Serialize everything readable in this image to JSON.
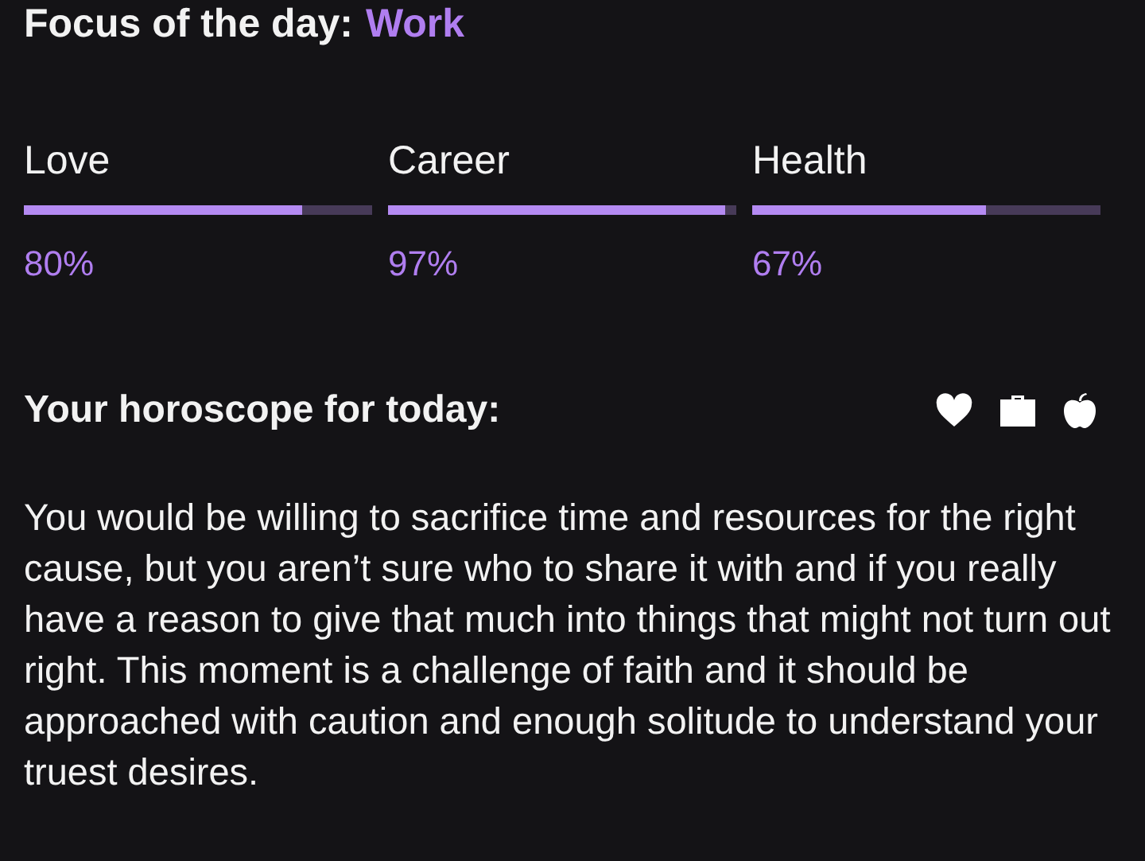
{
  "focus": {
    "label": "Focus of the day:",
    "value": "Work"
  },
  "meters": [
    {
      "name": "Love",
      "level": 0.8,
      "reading": "80%"
    },
    {
      "name": "Career",
      "level": 0.97,
      "reading": "97%"
    },
    {
      "name": "Health",
      "level": 0.67,
      "reading": "67%"
    }
  ],
  "horoscope": {
    "title": "Your horoscope for today:",
    "icons": [
      {
        "kind": "heart"
      },
      {
        "kind": "briefcase"
      },
      {
        "kind": "apple"
      }
    ],
    "text": "You would be willing to sacrifice time and resources for the right cause, but you aren’t sure who to share it with and if you really have a reason to give that much into things that might not turn out right. This moment is a challenge of faith and it should be approached with caution and enough solitude to understand your truest desires."
  }
}
